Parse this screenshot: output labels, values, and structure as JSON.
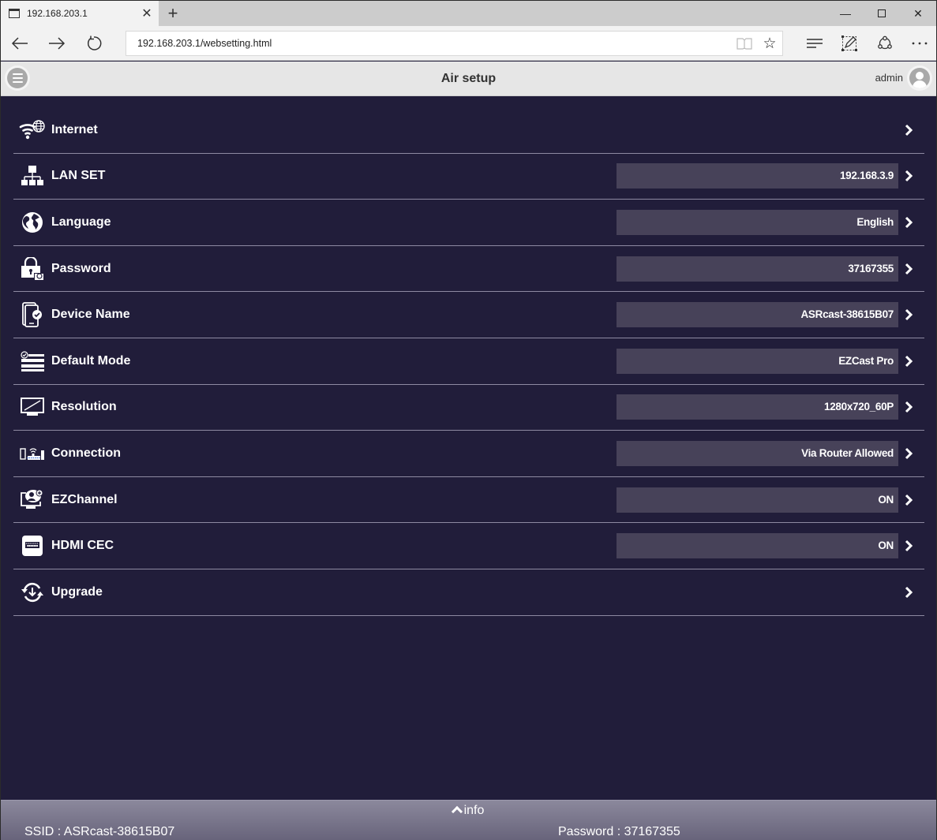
{
  "browser": {
    "tab_title": "192.168.203.1",
    "new_tab_icon": "plus-icon",
    "url": "192.168.203.1/websetting.html",
    "window_controls": [
      "minimize",
      "maximize",
      "close"
    ]
  },
  "app": {
    "title": "Air setup",
    "user": "admin"
  },
  "settings": [
    {
      "label": "Internet",
      "icon": "wifi-globe-icon",
      "value": null
    },
    {
      "label": "LAN SET",
      "icon": "network-icon",
      "value": "192.168.3.9"
    },
    {
      "label": "Language",
      "icon": "globe-icon",
      "value": "English"
    },
    {
      "label": "Password",
      "icon": "lock-icon",
      "value": "37167355"
    },
    {
      "label": "Device Name",
      "icon": "device-check-icon",
      "value": "ASRcast-38615B07"
    },
    {
      "label": "Default Mode",
      "icon": "list-check-icon",
      "value": "EZCast Pro"
    },
    {
      "label": "Resolution",
      "icon": "monitor-icon",
      "value": "1280x720_60P"
    },
    {
      "label": "Connection",
      "icon": "router-connection-icon",
      "value": "Via Router Allowed"
    },
    {
      "label": "EZChannel",
      "icon": "ezchannel-icon",
      "value": "ON"
    },
    {
      "label": "HDMI CEC",
      "icon": "hdmi-icon",
      "value": "ON"
    },
    {
      "label": "Upgrade",
      "icon": "upgrade-icon",
      "value": null
    }
  ],
  "footer": {
    "toggle_label": "info",
    "ssid": "SSID : ASRcast-38615B07",
    "password": "Password : 37167355"
  },
  "colors": {
    "background": "#211d3a",
    "value_box": "#474259",
    "divider": "#8e8aa2",
    "header": "#e6e6e6"
  }
}
